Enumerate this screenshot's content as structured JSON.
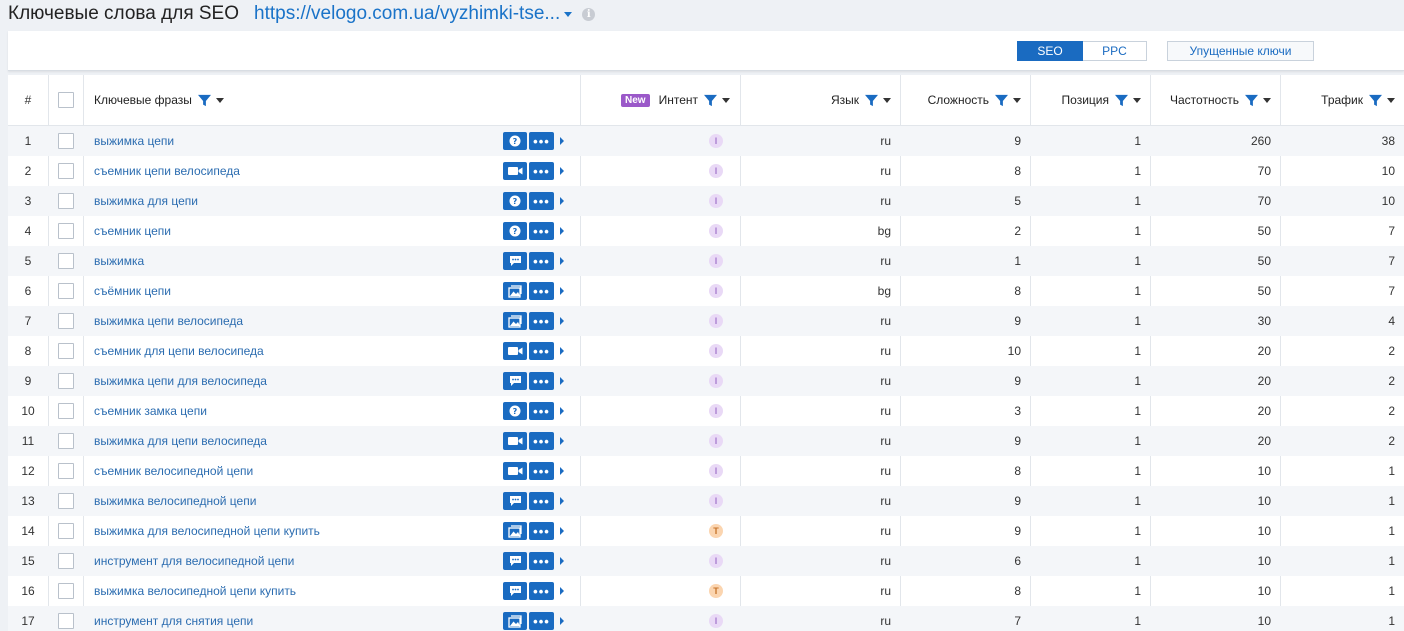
{
  "header": {
    "title": "Ключевые слова для SEO",
    "url": "https://velogo.com.ua/vyzhimki-tse..."
  },
  "toolbar": {
    "seo_label": "SEO",
    "ppc_label": "PPC",
    "missed_label": "Упущенные ключи"
  },
  "columns": {
    "num": "#",
    "keywords": "Ключевые фразы",
    "new_badge": "New",
    "intent": "Интент",
    "language": "Язык",
    "difficulty": "Сложность",
    "position": "Позиция",
    "frequency": "Частотность",
    "traffic": "Трафик"
  },
  "colors": {
    "accent": "#1a6bc1",
    "link": "#2b6cb0",
    "intent_i": "#e9d9f6",
    "intent_t": "#fbd5b0",
    "badge_new": "#9b59c9"
  },
  "rows": [
    {
      "n": "1",
      "kw": "выжимка цепи",
      "icon": "question-icon",
      "intent": "I",
      "lang": "ru",
      "diff": "9",
      "pos": "1",
      "freq": "260",
      "traffic": "38"
    },
    {
      "n": "2",
      "kw": "съемник цепи велосипеда",
      "icon": "video-icon",
      "intent": "I",
      "lang": "ru",
      "diff": "8",
      "pos": "1",
      "freq": "70",
      "traffic": "10"
    },
    {
      "n": "3",
      "kw": "выжимка для цепи",
      "icon": "question-icon",
      "intent": "I",
      "lang": "ru",
      "diff": "5",
      "pos": "1",
      "freq": "70",
      "traffic": "10"
    },
    {
      "n": "4",
      "kw": "съемник цепи",
      "icon": "question-icon",
      "intent": "I",
      "lang": "bg",
      "diff": "2",
      "pos": "1",
      "freq": "50",
      "traffic": "7"
    },
    {
      "n": "5",
      "kw": "выжимка",
      "icon": "review-icon",
      "intent": "I",
      "lang": "ru",
      "diff": "1",
      "pos": "1",
      "freq": "50",
      "traffic": "7"
    },
    {
      "n": "6",
      "kw": "съёмник цепи",
      "icon": "image-icon",
      "intent": "I",
      "lang": "bg",
      "diff": "8",
      "pos": "1",
      "freq": "50",
      "traffic": "7"
    },
    {
      "n": "7",
      "kw": "выжимка цепи велосипеда",
      "icon": "image-icon",
      "intent": "I",
      "lang": "ru",
      "diff": "9",
      "pos": "1",
      "freq": "30",
      "traffic": "4"
    },
    {
      "n": "8",
      "kw": "съемник для цепи велосипеда",
      "icon": "video-icon",
      "intent": "I",
      "lang": "ru",
      "diff": "10",
      "pos": "1",
      "freq": "20",
      "traffic": "2"
    },
    {
      "n": "9",
      "kw": "выжимка цепи для велосипеда",
      "icon": "review-icon",
      "intent": "I",
      "lang": "ru",
      "diff": "9",
      "pos": "1",
      "freq": "20",
      "traffic": "2"
    },
    {
      "n": "10",
      "kw": "съемник замка цепи",
      "icon": "question-icon",
      "intent": "I",
      "lang": "ru",
      "diff": "3",
      "pos": "1",
      "freq": "20",
      "traffic": "2"
    },
    {
      "n": "11",
      "kw": "выжимка для цепи велосипеда",
      "icon": "video-icon",
      "intent": "I",
      "lang": "ru",
      "diff": "9",
      "pos": "1",
      "freq": "20",
      "traffic": "2"
    },
    {
      "n": "12",
      "kw": "съемник велосипедной цепи",
      "icon": "video-icon",
      "intent": "I",
      "lang": "ru",
      "diff": "8",
      "pos": "1",
      "freq": "10",
      "traffic": "1"
    },
    {
      "n": "13",
      "kw": "выжимка велосипедной цепи",
      "icon": "review-icon",
      "intent": "I",
      "lang": "ru",
      "diff": "9",
      "pos": "1",
      "freq": "10",
      "traffic": "1"
    },
    {
      "n": "14",
      "kw": "выжимка для велосипедной цепи купить",
      "icon": "image-icon",
      "intent": "T",
      "lang": "ru",
      "diff": "9",
      "pos": "1",
      "freq": "10",
      "traffic": "1"
    },
    {
      "n": "15",
      "kw": "инструмент для велосипедной цепи",
      "icon": "review-icon",
      "intent": "I",
      "lang": "ru",
      "diff": "6",
      "pos": "1",
      "freq": "10",
      "traffic": "1"
    },
    {
      "n": "16",
      "kw": "выжимка велосипедной цепи купить",
      "icon": "review-icon",
      "intent": "T",
      "lang": "ru",
      "diff": "8",
      "pos": "1",
      "freq": "10",
      "traffic": "1"
    },
    {
      "n": "17",
      "kw": "инструмент для снятия цепи",
      "icon": "image-icon",
      "intent": "I",
      "lang": "ru",
      "diff": "7",
      "pos": "1",
      "freq": "10",
      "traffic": "1"
    }
  ]
}
